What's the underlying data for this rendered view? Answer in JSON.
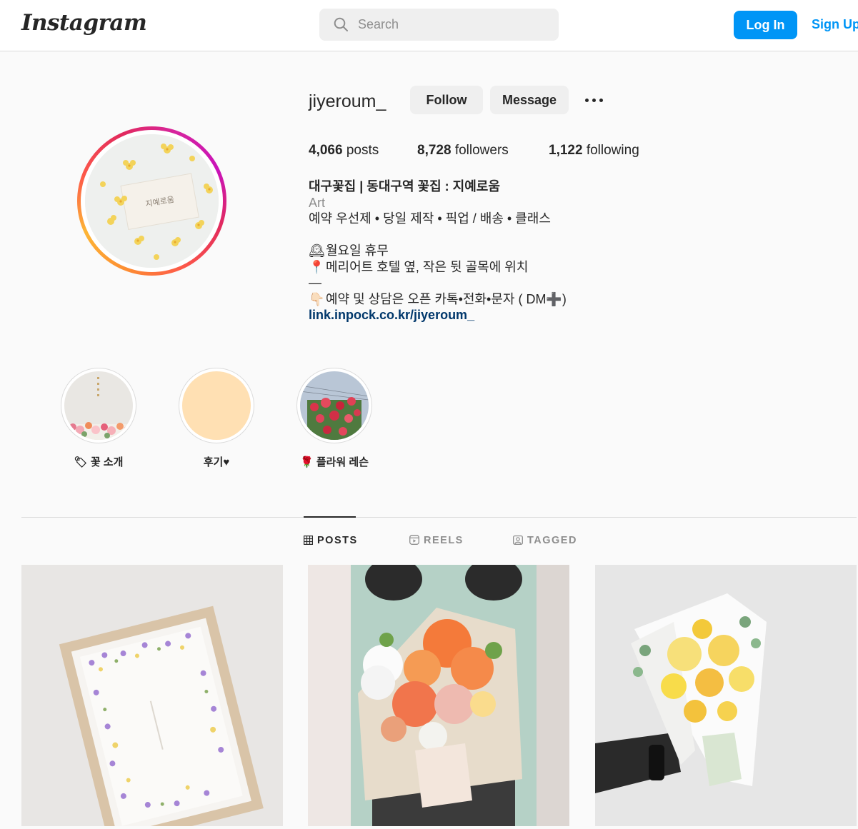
{
  "nav": {
    "logo": "Instagram",
    "search_placeholder": "Search",
    "login_label": "Log In",
    "signup_label": "Sign Up",
    "accent_color": "#0095f6"
  },
  "profile": {
    "username": "jiyeroum_",
    "follow_label": "Follow",
    "message_label": "Message",
    "avatar_card_text": "지예로움",
    "stats": {
      "posts_count": "4,066",
      "posts_label": "posts",
      "followers_count": "8,728",
      "followers_label": "followers",
      "following_count": "1,122",
      "following_label": "following"
    },
    "bio": {
      "name": "대구꽃집 | 동대구역 꽃집 : 지예로움",
      "category": "Art",
      "line1": "예약 우선제 • 당일 제작 • 픽업 / 배송 • 클래스",
      "line2_emoji": "🕰",
      "line2": "월요일 휴무",
      "line3_emoji": "📍",
      "line3": "메리어트 호텔 옆, 작은 뒷 골목에 위치",
      "line4": "—",
      "line5_emoji": "👇🏻",
      "line5": "예약 및 상담은 오픈 카톡•전화•문자 ( DM➕)",
      "link": "link.inpock.co.kr/jiyeroum_"
    }
  },
  "highlights": [
    {
      "label": "🏷 꽃 소개"
    },
    {
      "label": "후기♥"
    },
    {
      "label": "🌹 플라워 레슨"
    }
  ],
  "tabs": [
    {
      "label": "POSTS",
      "active": true
    },
    {
      "label": "REELS",
      "active": false
    },
    {
      "label": "TAGGED",
      "active": false
    }
  ]
}
